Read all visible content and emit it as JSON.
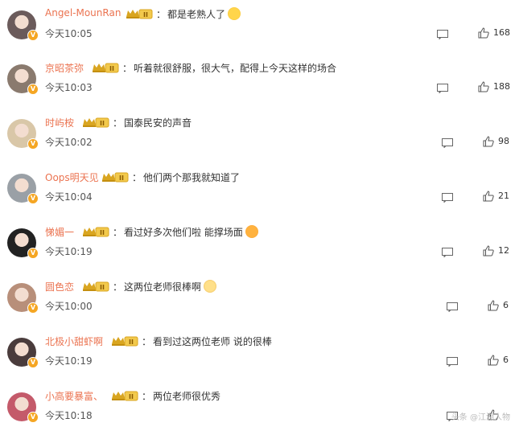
{
  "comments": [
    {
      "user": "Angel-MounRan",
      "text": "都是老熟人了",
      "time": "今天10:05",
      "likes": "168",
      "avatar_color": "#6b5b5b",
      "emoji": "smile"
    },
    {
      "user": "京昭茶弥",
      "text": "听着就很舒服，很大气，配得上今天这样的场合",
      "time": "今天10:03",
      "likes": "188",
      "avatar_color": "#8a7a6e",
      "emoji": ""
    },
    {
      "user": "时屿桉",
      "text": "国泰民安的声音",
      "time": "今天10:02",
      "likes": "98",
      "avatar_color": "#d9c7a8",
      "emoji": ""
    },
    {
      "user": "Oops明天见",
      "text": "他们两个那我就知道了",
      "time": "今天10:04",
      "likes": "21",
      "avatar_color": "#9aa0a6",
      "emoji": ""
    },
    {
      "user": "悌媚一",
      "text": "看过好多次他们啦 能撑场面",
      "time": "今天10:19",
      "likes": "12",
      "avatar_color": "#222222",
      "emoji": "love"
    },
    {
      "user": "圆色恋",
      "text": "这两位老师很棒啊",
      "time": "今天10:00",
      "likes": "6",
      "avatar_color": "#b88f7a",
      "emoji": "clap"
    },
    {
      "user": "北极小甜虾啊",
      "text": "看到过这两位老师 说的很棒",
      "time": "今天10:19",
      "likes": "6",
      "avatar_color": "#4a3c3c",
      "emoji": ""
    },
    {
      "user": "小高要暴富、",
      "text": "两位老师很优秀",
      "time": "今天10:18",
      "likes": "",
      "avatar_color": "#c45a6a",
      "emoji": ""
    }
  ],
  "level_badge_text": "II",
  "verified_mark": "V",
  "watermark": "头条 @江湖人物"
}
